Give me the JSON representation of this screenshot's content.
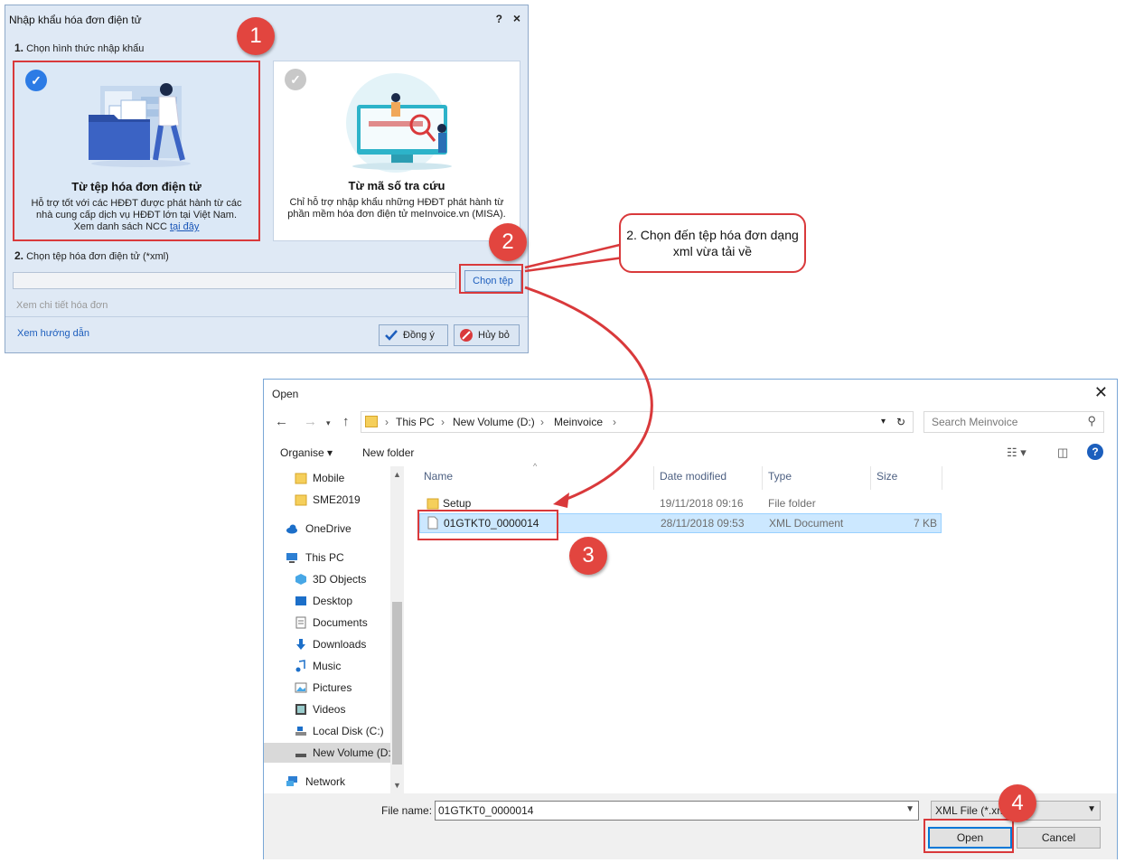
{
  "import_dialog": {
    "title": "Nhập khẩu hóa đơn điện tử",
    "help": "?",
    "close": "×",
    "step1_num": "1.",
    "step1_label": "Chọn hình thức nhập khẩu",
    "card1": {
      "title": "Từ tệp hóa đơn điện tử",
      "desc": "Hỗ trợ tốt với các HĐĐT được phát hành từ các nhà cung cấp dịch vụ HĐĐT lớn tại Việt Nam.",
      "desc2": "Xem danh sách NCC",
      "link": "tại đây"
    },
    "card2": {
      "title": "Từ mã số tra cứu",
      "desc": "Chỉ hỗ trợ nhập khẩu những HĐĐT phát hành từ phần mềm hóa đơn điện tử meInvoice.vn (MISA)."
    },
    "step2_num": "2.",
    "step2_label": "Chọn tệp hóa đơn điện tử (*xml)",
    "choose_file": "Chọn tệp",
    "view_detail": "Xem chi tiết hóa đơn",
    "guide": "Xem hướng dẫn",
    "ok": "Đồng ý",
    "cancel": "Hủy bỏ"
  },
  "markers": [
    "1",
    "2",
    "3",
    "4"
  ],
  "callout": "2. Chọn đến tệp hóa đơn dạng xml vừa tải về",
  "open_dialog": {
    "title": "Open",
    "close": "✕",
    "breadcrumb": [
      "This PC",
      "New Volume (D:)",
      "Meinvoice"
    ],
    "search_placeholder": "Search Meinvoice",
    "organise": "Organise ▾",
    "new_folder": "New folder",
    "nav": [
      {
        "label": "Mobile",
        "icon": "folder-icon"
      },
      {
        "label": "SME2019",
        "icon": "folder-icon"
      },
      {
        "label": "OneDrive",
        "icon": "cloud-icon"
      },
      {
        "label": "This PC",
        "icon": "computer-icon"
      },
      {
        "label": "3D Objects",
        "icon": "cube-icon"
      },
      {
        "label": "Desktop",
        "icon": "desktop-icon"
      },
      {
        "label": "Documents",
        "icon": "document-icon"
      },
      {
        "label": "Downloads",
        "icon": "download-icon"
      },
      {
        "label": "Music",
        "icon": "music-icon"
      },
      {
        "label": "Pictures",
        "icon": "picture-icon"
      },
      {
        "label": "Videos",
        "icon": "video-icon"
      },
      {
        "label": "Local Disk (C:)",
        "icon": "disk-icon"
      },
      {
        "label": "New Volume (D:)",
        "icon": "drive-icon"
      },
      {
        "label": "Network",
        "icon": "network-icon"
      }
    ],
    "columns": [
      "Name",
      "Date modified",
      "Type",
      "Size"
    ],
    "files": [
      {
        "name": "Setup",
        "date": "19/11/2018 09:16",
        "type": "File folder",
        "size": ""
      },
      {
        "name": "01GTKT0_0000014",
        "date": "28/11/2018 09:53",
        "type": "XML Document",
        "size": "7 KB"
      }
    ],
    "file_name_label": "File name:",
    "file_name_value": "01GTKT0_0000014",
    "file_type": "XML File (*.xml)",
    "open": "Open",
    "cancel": "Cancel"
  }
}
